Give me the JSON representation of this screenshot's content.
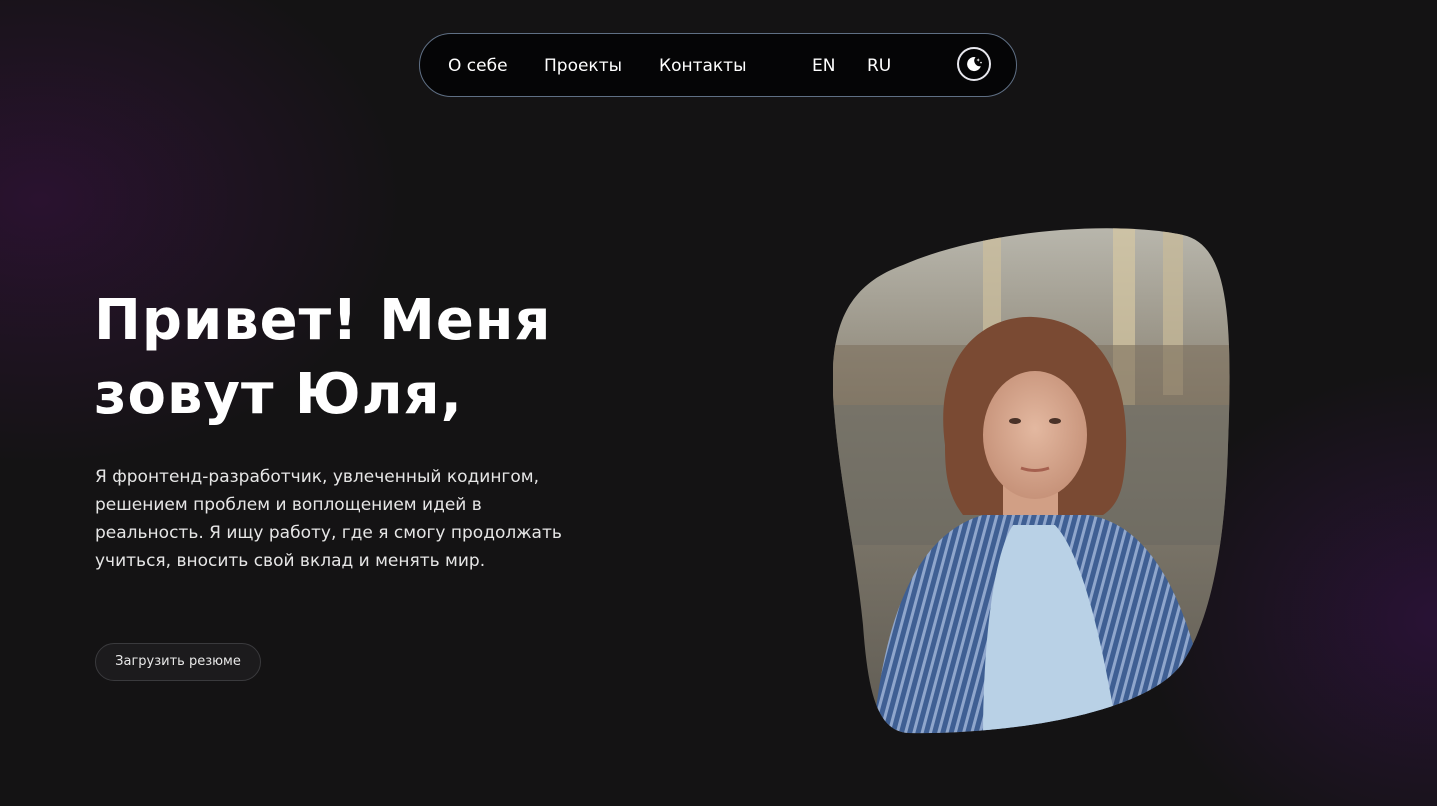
{
  "nav": {
    "links": [
      "О себе",
      "Проекты",
      "Контакты"
    ],
    "languages": [
      "EN",
      "RU"
    ],
    "theme_icon": "moon-stars-icon"
  },
  "hero": {
    "title_line1": "Привет! Меня",
    "title_line2": "зовут Юля,",
    "description": "Я фронтенд-разработчик, увлеченный кодингом, решением проблем и воплощением идей в реальность. Я ищу работу, где я смогу продолжать учиться, вносить свой вклад и менять мир.",
    "resume_button": "Загрузить резюме"
  },
  "colors": {
    "background": "#141314",
    "nav_background": "#050506",
    "nav_border": "#5f6f84",
    "accent_glow": "#3c1246"
  }
}
